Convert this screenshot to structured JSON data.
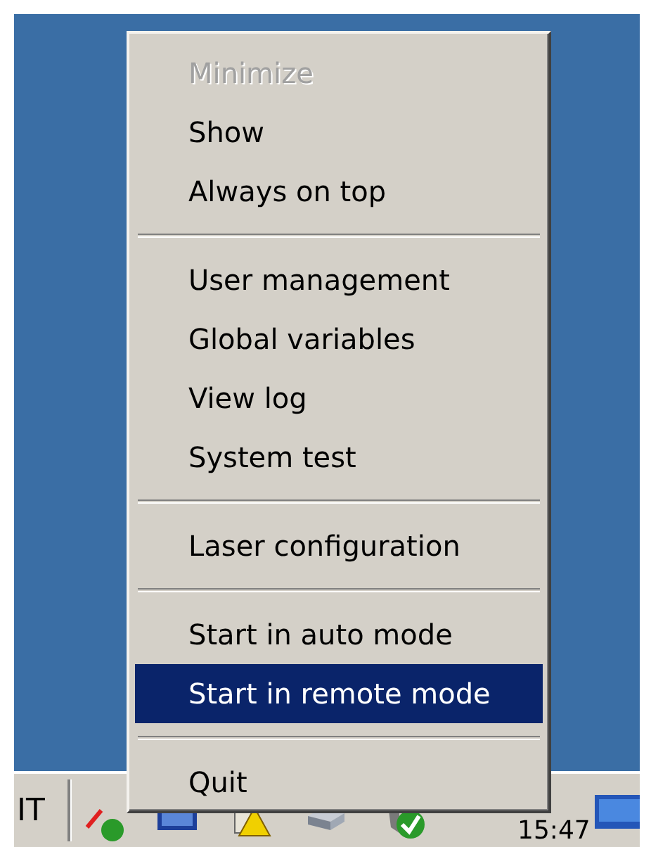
{
  "menu": {
    "items": [
      {
        "kind": "item",
        "label": "Minimize",
        "disabled": true,
        "selected": false
      },
      {
        "kind": "item",
        "label": "Show",
        "disabled": false,
        "selected": false
      },
      {
        "kind": "item",
        "label": "Always on top",
        "disabled": false,
        "selected": false
      },
      {
        "kind": "separator"
      },
      {
        "kind": "item",
        "label": "User management",
        "disabled": false,
        "selected": false
      },
      {
        "kind": "item",
        "label": "Global variables",
        "disabled": false,
        "selected": false
      },
      {
        "kind": "item",
        "label": "View log",
        "disabled": false,
        "selected": false
      },
      {
        "kind": "item",
        "label": "System test",
        "disabled": false,
        "selected": false
      },
      {
        "kind": "separator"
      },
      {
        "kind": "item",
        "label": "Laser configuration",
        "disabled": false,
        "selected": false
      },
      {
        "kind": "separator"
      },
      {
        "kind": "item",
        "label": "Start in auto mode",
        "disabled": false,
        "selected": false
      },
      {
        "kind": "item",
        "label": "Start in remote mode",
        "disabled": false,
        "selected": true
      },
      {
        "kind": "separator"
      },
      {
        "kind": "item",
        "label": "Quit",
        "disabled": false,
        "selected": false
      }
    ]
  },
  "taskbar": {
    "label": "IT",
    "clock": "15:47"
  }
}
